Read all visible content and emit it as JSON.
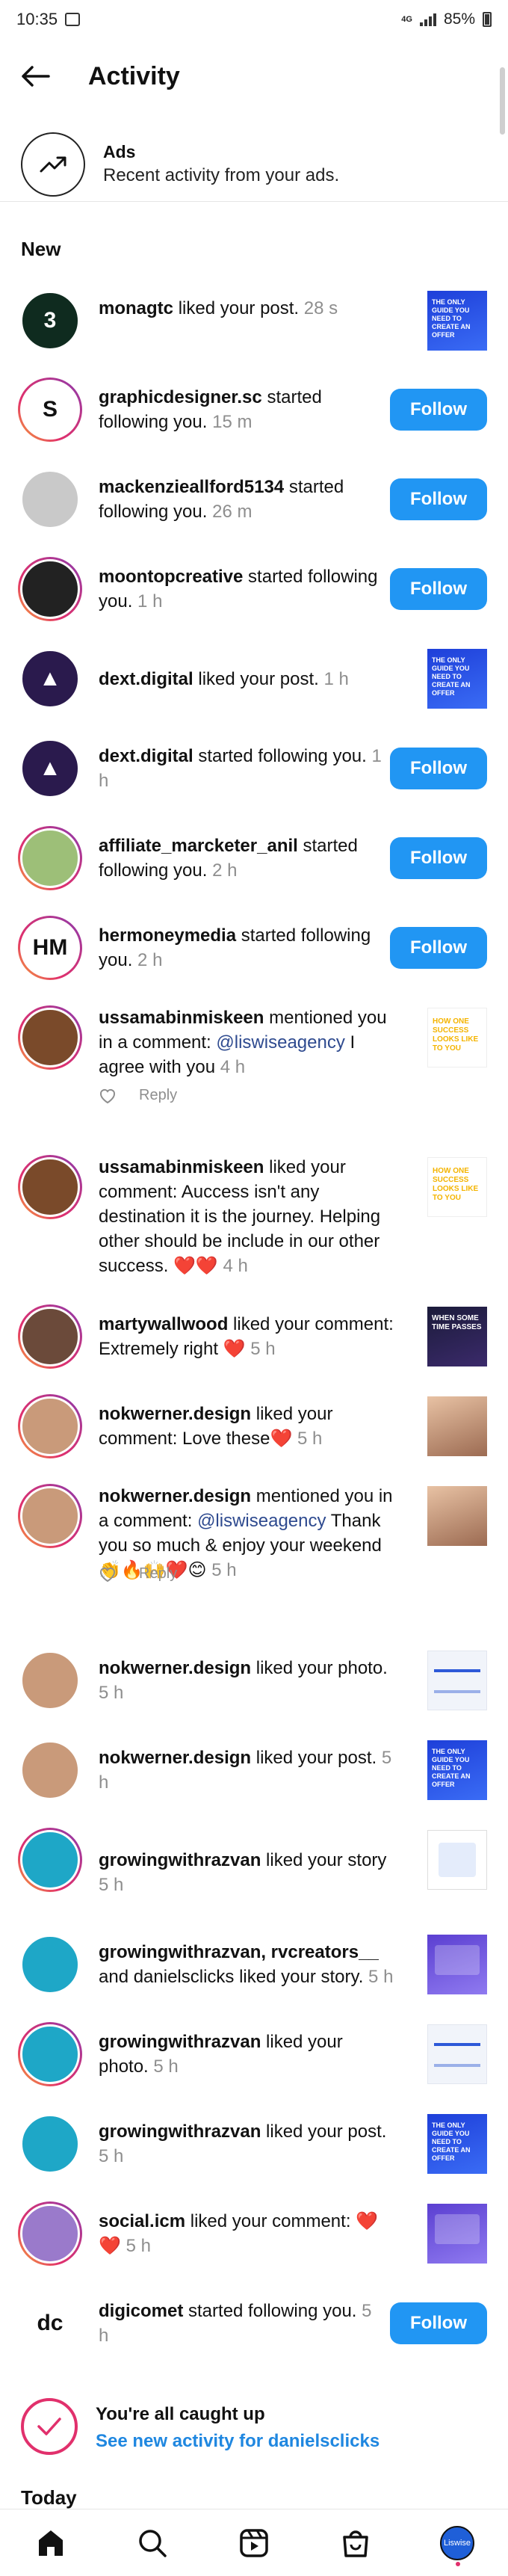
{
  "status_bar": {
    "time": "10:35",
    "network": "4G",
    "battery": "85%"
  },
  "header": {
    "title": "Activity"
  },
  "ads": {
    "title": "Ads",
    "subtitle": "Recent activity from your ads."
  },
  "sections": {
    "new": "New",
    "today": "Today"
  },
  "colors": {
    "follow_button": "#2196f3",
    "link": "#1f87e0",
    "mention": "#2e4a8f",
    "timestamp": "#8e8e8e",
    "like_heart": "#e41e3f"
  },
  "follow_label": "Follow",
  "reply_label": "Reply",
  "notifications": [
    {
      "user": "monagtc",
      "text": "liked your post.",
      "time": "28 s",
      "action": "thumb",
      "thumb": "blue-post"
    },
    {
      "user": "graphicdesigner.sc",
      "text": "started following you.",
      "time": "15 m",
      "action": "follow"
    },
    {
      "user": "mackenzieallford5134",
      "text": "started following you.",
      "time": "26 m",
      "action": "follow"
    },
    {
      "user": "moontopcreative",
      "text": "started following you.",
      "time": "1 h",
      "action": "follow"
    },
    {
      "user": "dext.digital",
      "text": "liked your post.",
      "time": "1 h",
      "action": "thumb",
      "thumb": "blue-post"
    },
    {
      "user": "dext.digital",
      "text": "started following you.",
      "time": "1 h",
      "action": "follow"
    },
    {
      "user": "affiliate_marcketer_anil",
      "text": "started following you.",
      "time": "2 h",
      "action": "follow"
    },
    {
      "user": "hermoneymedia",
      "text": "started following you.",
      "time": "2 h",
      "action": "follow"
    },
    {
      "user": "ussamabinmiskeen",
      "text": "mentioned you in a comment:",
      "mention": "@liswiseagency",
      "text2": "I agree with you",
      "time": "4 h",
      "action": "thumb",
      "thumb": "success-post",
      "reply": true
    },
    {
      "user": "ussamabinmiskeen",
      "text": "liked your comment: Auccess isn't any destination it is the journey.  Helping other should be include in our other success. ❤️❤️",
      "time": "4 h",
      "action": "thumb",
      "thumb": "success-post"
    },
    {
      "user": "martywallwood",
      "text": "liked your comment: Extremely right ❤️",
      "time": "5 h",
      "action": "thumb",
      "thumb": "dark-post"
    },
    {
      "user": "nokwerner.design",
      "text": "liked your comment: Love these❤️",
      "time": "5 h",
      "action": "thumb",
      "thumb": "photo-post"
    },
    {
      "user": "nokwerner.design",
      "text": "mentioned you in a comment:",
      "mention": "@liswiseagency",
      "text2": "Thank you so much & enjoy your weekend 👏🔥🙌❤️😊",
      "time": "5 h",
      "action": "thumb",
      "thumb": "photo-post",
      "reply": true
    },
    {
      "user": "nokwerner.design",
      "text": "liked your photo.",
      "time": "5 h",
      "action": "thumb",
      "thumb": "light-post"
    },
    {
      "user": "nokwerner.design",
      "text": "liked your post.",
      "time": "5 h",
      "action": "thumb",
      "thumb": "blue-post"
    },
    {
      "user": "growingwithrazvan",
      "text": "liked your story",
      "time": "5 h",
      "action": "thumb",
      "thumb": "story-post"
    },
    {
      "user": "growingwithrazvan, rvcreators__",
      "text": "and danielsclicks liked your story.",
      "time": "5 h",
      "action": "thumb",
      "thumb": "purple-post"
    },
    {
      "user": "growingwithrazvan",
      "text": "liked your photo.",
      "time": "5 h",
      "action": "thumb",
      "thumb": "light-post"
    },
    {
      "user": "growingwithrazvan",
      "text": "liked your post.",
      "time": "5 h",
      "action": "thumb",
      "thumb": "blue-post"
    },
    {
      "user": "social.icm",
      "text": "liked your comment: ❤️❤️",
      "time": "5 h",
      "action": "thumb",
      "thumb": "purple-post"
    },
    {
      "user": "digicomet",
      "text": "started following you.",
      "time": "5 h",
      "action": "follow"
    }
  ],
  "caught_up": {
    "title": "You're all caught up",
    "link": "See new activity for danielsclicks"
  },
  "bottom_nav": {
    "profile_label": "Liswise"
  }
}
